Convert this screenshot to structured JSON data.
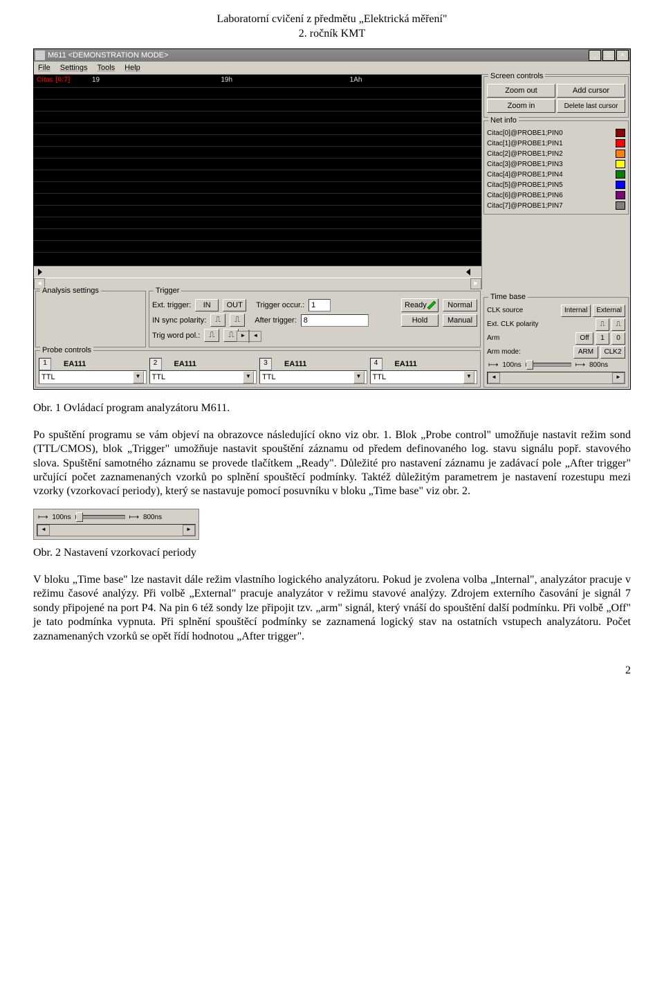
{
  "doc": {
    "header_line1": "Laboratorní cvičení z předmětu „Elektrická měření\"",
    "header_line2": "2. ročník KMT",
    "page_number": "2"
  },
  "app": {
    "title": "M611 <DEMONSTRATION MODE>",
    "menu": [
      "File",
      "Settings",
      "Tools",
      "Help"
    ],
    "win_buttons": {
      "min": "_",
      "max": "□",
      "close": "×"
    },
    "waveform": {
      "row_label": "Citac [0:7]",
      "columns": [
        "19",
        "19h",
        "1Ah"
      ]
    },
    "screen_controls": {
      "title": "Screen controls",
      "zoom_out": "Zoom out",
      "zoom_in": "Zoom in",
      "add_cursor": "Add cursor",
      "del_cursor": "Delete last cursor"
    },
    "net_info": {
      "title": "Net info",
      "items": [
        {
          "label": "Citac[0]@PROBE1;PIN0",
          "color": "#8b0000"
        },
        {
          "label": "Citac[1]@PROBE1;PIN1",
          "color": "#ff0000"
        },
        {
          "label": "Citac[2]@PROBE1;PIN2",
          "color": "#ff8000"
        },
        {
          "label": "Citac[3]@PROBE1;PIN3",
          "color": "#ffff00"
        },
        {
          "label": "Citac[4]@PROBE1;PIN4",
          "color": "#008000"
        },
        {
          "label": "Citac[5]@PROBE1;PIN5",
          "color": "#0000ff"
        },
        {
          "label": "Citac[6]@PROBE1;PIN6",
          "color": "#800080"
        },
        {
          "label": "Citac[7]@PROBE1;PIN7",
          "color": "#808080"
        }
      ]
    },
    "timebase": {
      "title": "Time base",
      "clk_source_label": "CLK source",
      "clk_internal": "Internal",
      "clk_external": "External",
      "ext_polarity_label": "Ext. CLK polarity",
      "arm_label": "Arm",
      "arm_off": "Off",
      "arm_1": "1",
      "arm_0": "0",
      "arm_mode_label": "Arm mode:",
      "arm_mode_arm": "ARM",
      "arm_mode_clk2": "CLK2",
      "slider_left": "100ns",
      "slider_right": "800ns"
    },
    "analysis": {
      "title": "Analysis settings"
    },
    "trigger": {
      "title": "Trigger",
      "ext_trigger_label": "Ext. trigger:",
      "in": "IN",
      "out": "OUT",
      "occur_label": "Trigger occur.:",
      "occur_value": "1",
      "ready": "Ready",
      "normal": "Normal",
      "sync_label": "IN sync polarity:",
      "after_label": "After trigger:",
      "after_value": "8",
      "hold": "Hold",
      "manual": "Manual",
      "word_label": "Trig word pol.:"
    },
    "probe": {
      "title": "Probe controls",
      "slots": [
        {
          "num": "1",
          "name": "EA111",
          "mode": "TTL"
        },
        {
          "num": "2",
          "name": "EA111",
          "mode": "TTL"
        },
        {
          "num": "3",
          "name": "EA111",
          "mode": "TTL"
        },
        {
          "num": "4",
          "name": "EA111",
          "mode": "TTL"
        }
      ]
    }
  },
  "text": {
    "caption1": "Obr. 1 Ovládací program analyzátoru M611.",
    "para1": "Po spuštění programu se vám objeví na obrazovce následující okno viz obr. 1. Blok „Probe control\" umožňuje nastavit režim sond (TTL/CMOS), blok „Trigger\" umožňuje nastavit spouštění záznamu od předem definovaného log. stavu signálu popř. stavového slova. Spuštění samotného záznamu se provede tlačítkem „Ready\". Důležité pro nastavení záznamu je zadávací pole „After trigger\" určující počet zaznamenaných vzorků po splnění spouštěcí podmínky. Taktéž důležitým parametrem je nastavení rozestupu mezi vzorky (vzorkovací periody), který se nastavuje pomocí posuvníku v bloku „Time base\" viz obr. 2.",
    "caption2": "Obr. 2 Nastavení vzorkovací periody",
    "para2": "V bloku „Time base\" lze nastavit dále režim vlastního logického analyzátoru. Pokud je zvolena volba „Internal\", analyzátor pracuje v režimu časové analýzy. Při volbě „External\" pracuje analyzátor v režimu stavové analýzy. Zdrojem externího časování je signál 7 sondy připojené na port P4. Na pin 6 též sondy lze připojit tzv. „arm\" signál, který vnáší do spouštění další podmínku. Při volbě „Off\" je tato podmínka vypnuta. Při splnění spouštěcí podmínky se zaznamená logický stav na ostatních vstupech analyzátoru. Počet zaznamenaných vzorků se opět řídí hodnotou „After trigger\"."
  },
  "timebase_detail": {
    "left": "100ns",
    "right": "800ns"
  }
}
